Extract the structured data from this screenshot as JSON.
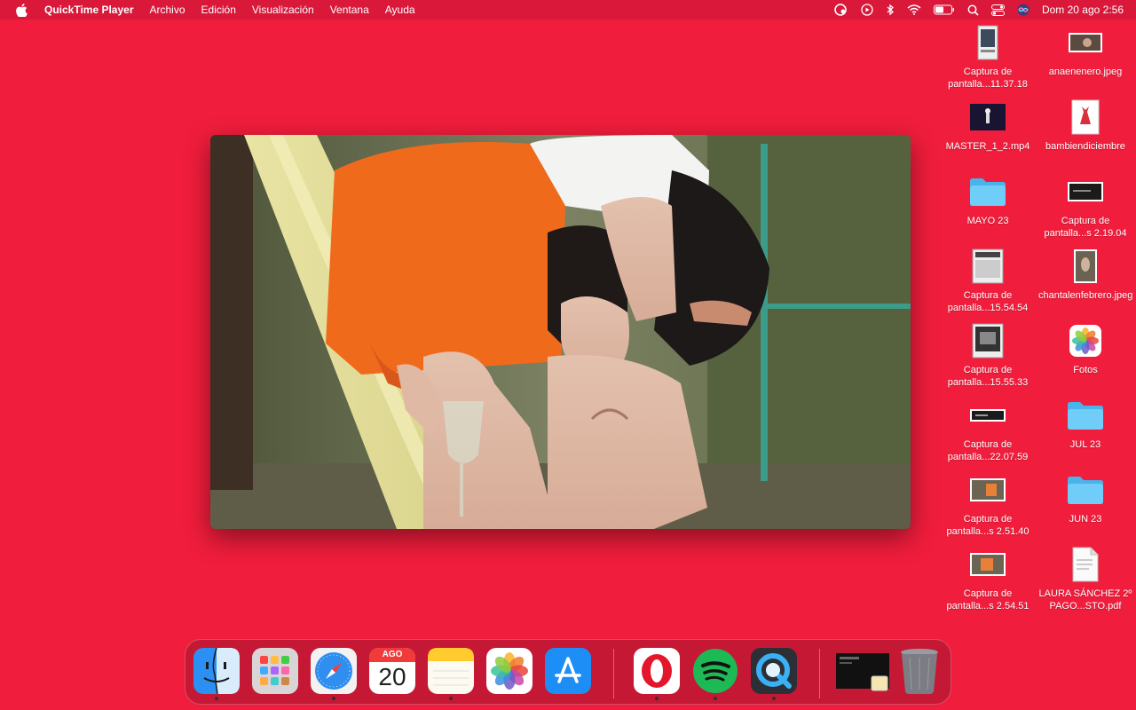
{
  "menubar": {
    "apple_icon": "apple-icon",
    "app_name": "QuickTime Player",
    "menus": [
      "Archivo",
      "Edición",
      "Visualización",
      "Ventana",
      "Ayuda"
    ],
    "status_icons": [
      "creative-cloud-icon",
      "play-icon",
      "bluetooth-icon",
      "wifi-icon",
      "battery-icon",
      "search-icon",
      "control-center-icon",
      "siri-icon"
    ],
    "clock": "Dom 20 ago  2:56"
  },
  "window": {
    "app": "QuickTime Player",
    "content": "video-frame"
  },
  "desktop": {
    "icons": [
      {
        "label": "Captura de pantalla...11.37.18",
        "icon": "screenshot-thumb-icon"
      },
      {
        "label": "anaenenero.jpeg",
        "icon": "image-thumb-icon"
      },
      {
        "label": "MASTER_1_2.mp4",
        "icon": "video-thumb-icon"
      },
      {
        "label": "bambiendiciembre",
        "icon": "image-thumb-icon"
      },
      {
        "label": "MAYO 23",
        "icon": "folder-icon"
      },
      {
        "label": "Captura de pantalla...s 2.19.04",
        "icon": "screenshot-thumb-icon"
      },
      {
        "label": "Captura de pantalla...15.54.54",
        "icon": "screenshot-thumb-icon"
      },
      {
        "label": "chantalenfebrero.jpeg",
        "icon": "image-thumb-icon"
      },
      {
        "label": "Captura de pantalla...15.55.33",
        "icon": "screenshot-thumb-icon"
      },
      {
        "label": "Fotos",
        "icon": "photos-app-icon"
      },
      {
        "label": "Captura de pantalla...22.07.59",
        "icon": "screenshot-thumb-icon"
      },
      {
        "label": "JUL 23",
        "icon": "folder-icon"
      },
      {
        "label": "Captura de pantalla...s 2.51.40",
        "icon": "screenshot-thumb-icon"
      },
      {
        "label": "JUN 23",
        "icon": "folder-icon"
      },
      {
        "label": "Captura de pantalla...s 2.54.51",
        "icon": "screenshot-thumb-icon"
      },
      {
        "label": "LAURA SÁNCHEZ 2º PAGO...STO.pdf",
        "icon": "pdf-file-icon"
      }
    ]
  },
  "dock": {
    "calendar_month": "AGO",
    "calendar_day": "20",
    "apps": [
      "finder-icon",
      "launchpad-icon",
      "safari-icon",
      "calendar-icon",
      "notes-icon",
      "photos-icon",
      "app-store-icon",
      "opera-icon",
      "spotify-icon",
      "quicktime-icon",
      "screenshot-stack-icon",
      "trash-icon"
    ]
  },
  "colors": {
    "desktop": "#f11d3c",
    "menubar": "#d9183a",
    "folder": "#5ac8fa"
  }
}
